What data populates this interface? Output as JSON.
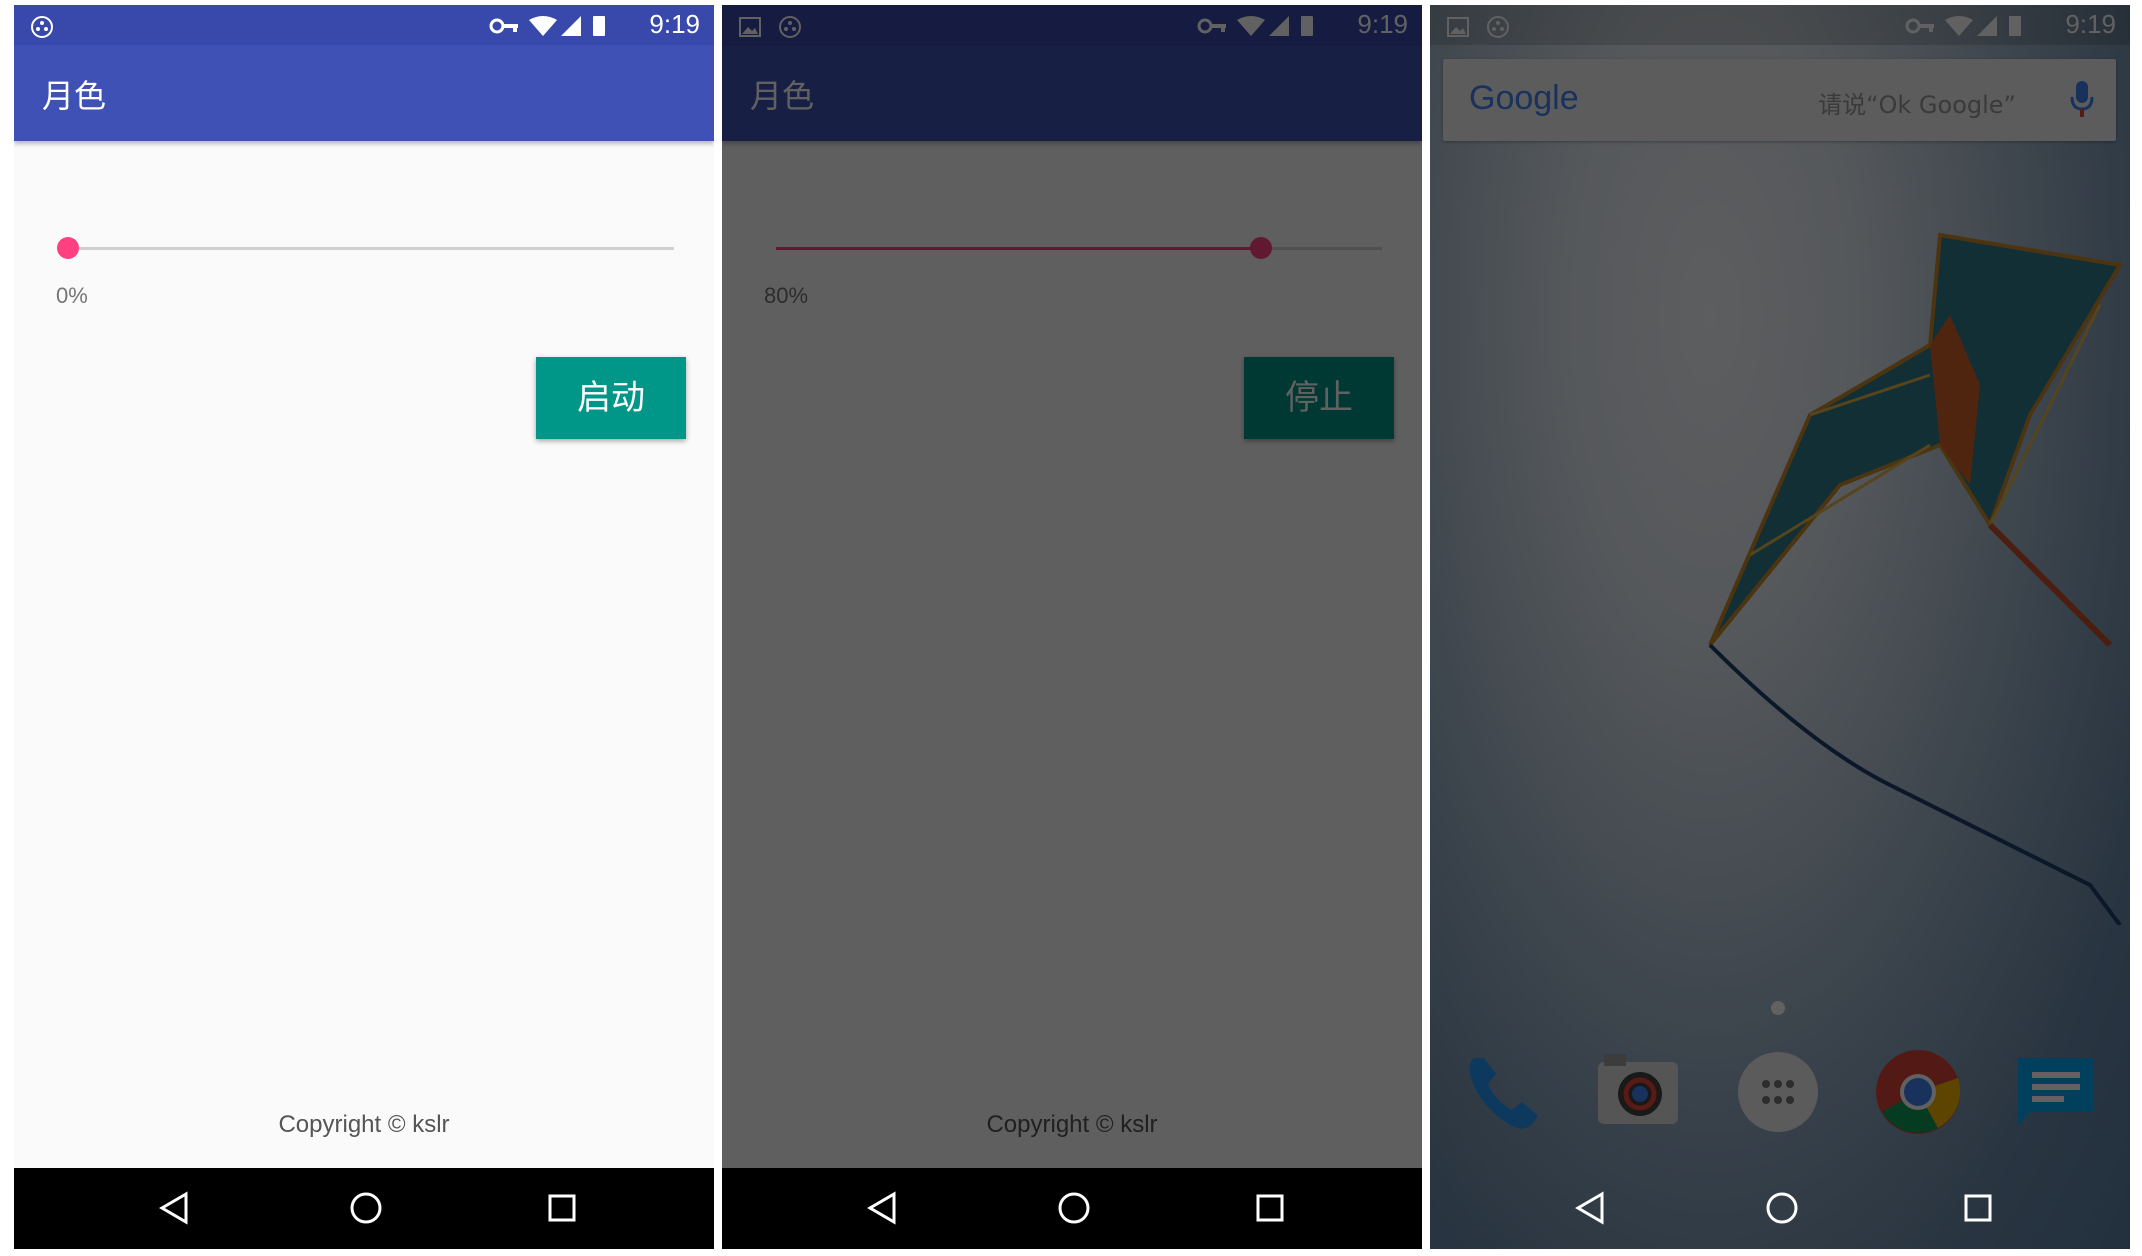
{
  "status_bar": {
    "time": "9:19"
  },
  "panels": [
    {
      "app_title": "月色",
      "slider_value_percent": 0,
      "slider_label": "0%",
      "button_label": "启动",
      "copyright": "Copyright © kslr",
      "dimmed": false
    },
    {
      "app_title": "月色",
      "slider_value_percent": 80,
      "slider_label": "80%",
      "button_label": "停止",
      "copyright": "Copyright © kslr",
      "dimmed": true
    }
  ],
  "launcher": {
    "search_logo": "Google",
    "search_hint": "请说“Ok Google”",
    "dock_icons": [
      "phone-icon",
      "camera-icon",
      "app-drawer-icon",
      "chrome-icon",
      "messages-icon"
    ]
  },
  "nav_buttons": [
    "back-icon",
    "home-icon",
    "recents-icon"
  ],
  "colors": {
    "app_bar": "#3f51b5",
    "status_bar": "#3949ab",
    "accent": "#ff4081",
    "button": "#009688",
    "background": "#fafafa"
  }
}
